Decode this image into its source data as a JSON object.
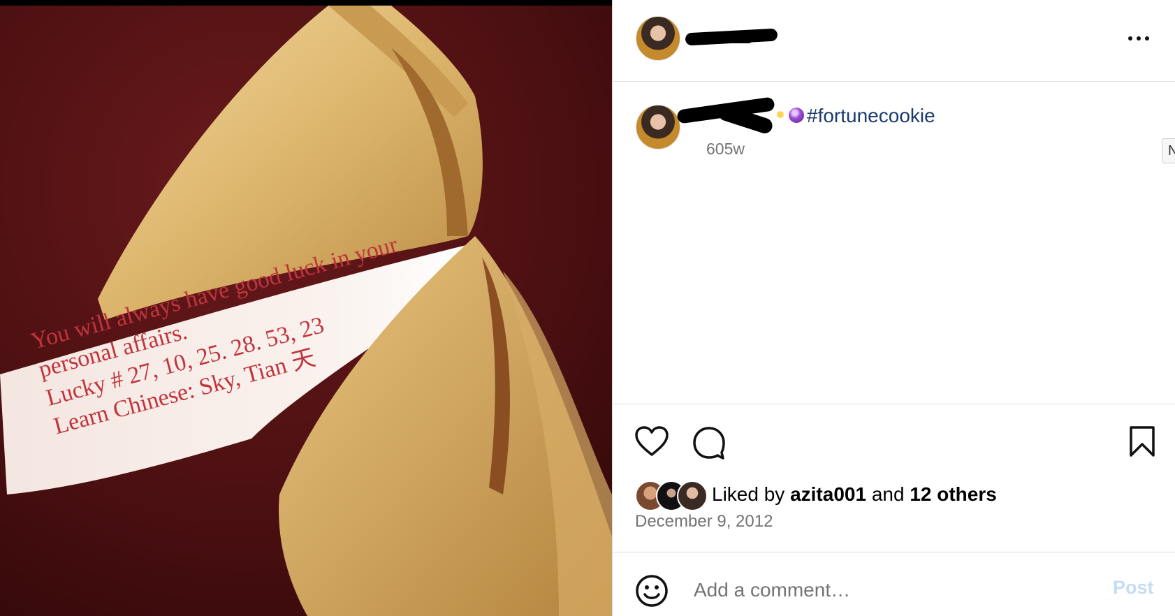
{
  "photo": {
    "fortune_lines": [
      "You will always have good luck in your",
      "personal affairs.",
      "Lucky # 27, 10, 25. 28. 53, 23",
      "Learn Chinese: Sky, Tian 天"
    ]
  },
  "header": {
    "more_icon": "more-horizontal-icon"
  },
  "caption": {
    "hashtag": "#fortunecookie",
    "time_ago": "605w",
    "emoji": "crystal-ball"
  },
  "edge_tab": {
    "label": "N"
  },
  "actions": {
    "like_icon": "heart-icon",
    "comment_icon": "comment-icon",
    "save_icon": "bookmark-icon"
  },
  "likes": {
    "prefix": "Liked by",
    "user": "azita001",
    "middle": "and",
    "others": "12 others"
  },
  "post_date": "December 9, 2012",
  "comment": {
    "placeholder": "Add a comment…",
    "post_label": "Post"
  },
  "colors": {
    "hashtag": "#1a3a6e",
    "post_disabled": "#c5dcf5",
    "fortune_ink": "#c0343d"
  }
}
